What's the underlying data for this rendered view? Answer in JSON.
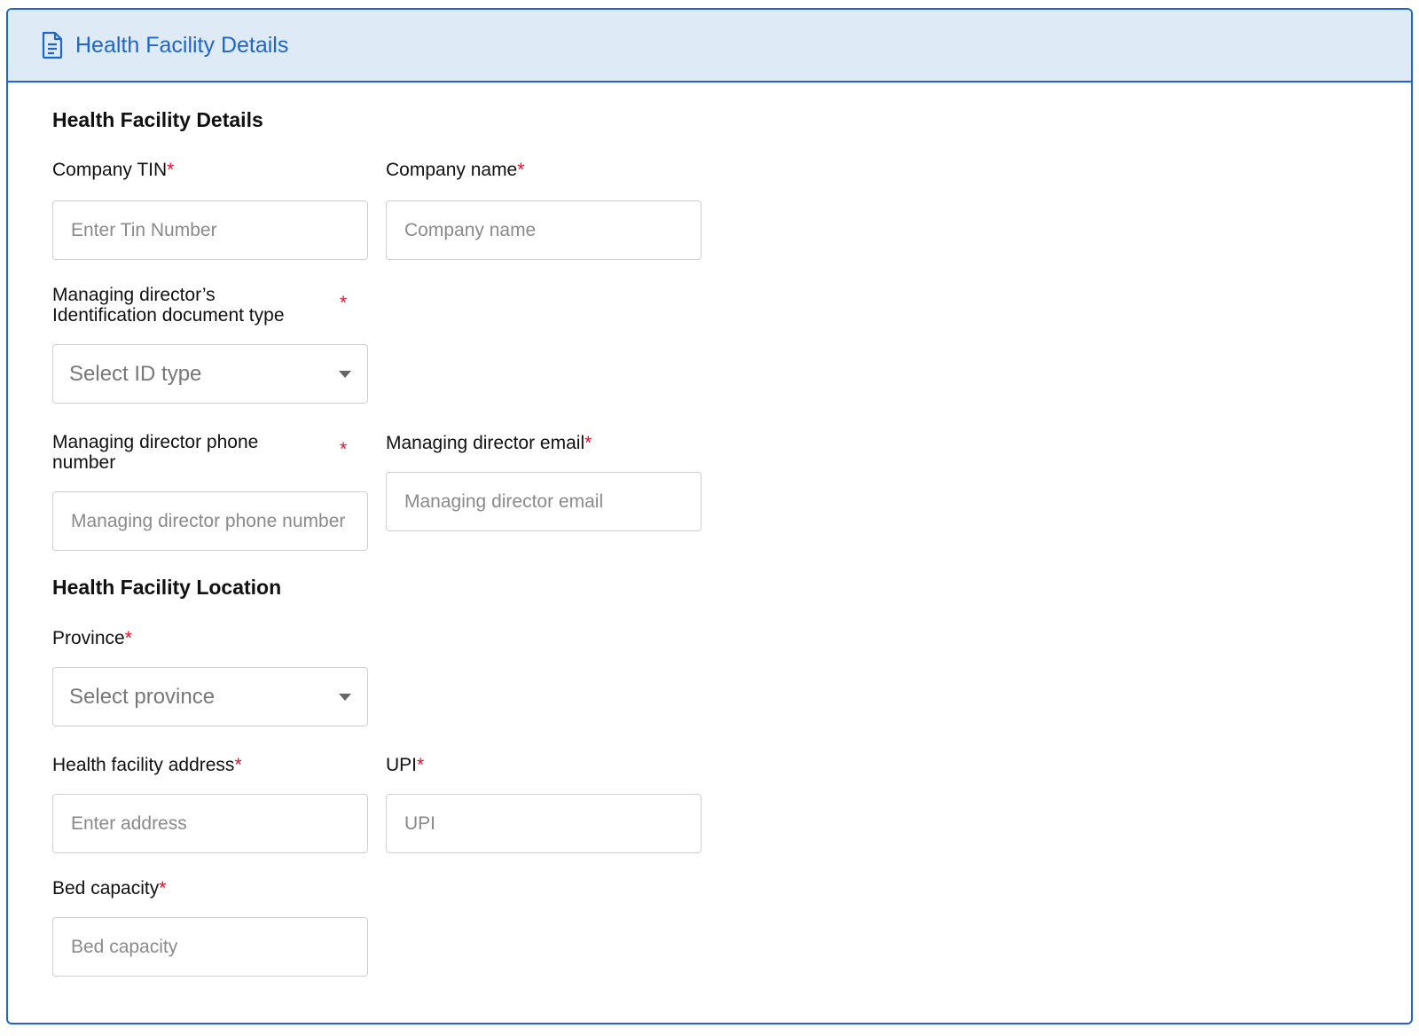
{
  "header": {
    "icon": "document-icon",
    "title": "Health Facility Details",
    "accent_color": "#1f66c7",
    "background_color": "#deebf6"
  },
  "sections": {
    "details_title": "Health Facility Details",
    "location_title": "Health Facility Location"
  },
  "fields": {
    "company_tin": {
      "label": "Company TIN",
      "required": "*",
      "placeholder": "Enter Tin Number"
    },
    "company_name": {
      "label": "Company name",
      "required": "*",
      "placeholder": "Company name"
    },
    "id_doc_type": {
      "label_line1": "Managing director’s",
      "label_line2": "Identification document type",
      "required": "*",
      "placeholder": "Select ID type"
    },
    "md_phone": {
      "label_line1": "Managing director phone",
      "label_line2": "number",
      "required": "*",
      "placeholder": "Managing director phone number"
    },
    "md_email": {
      "label": "Managing director email",
      "required": "*",
      "placeholder": "Managing director email"
    },
    "province": {
      "label": "Province",
      "required": "*",
      "placeholder": "Select province"
    },
    "address": {
      "label": "Health facility address",
      "required": "*",
      "placeholder": "Enter address"
    },
    "upi": {
      "label": "UPI",
      "required": "*",
      "placeholder": "UPI"
    },
    "bed_capacity": {
      "label": "Bed capacity",
      "required": "*",
      "placeholder": "Bed capacity"
    }
  },
  "required_color": "#e0102c"
}
